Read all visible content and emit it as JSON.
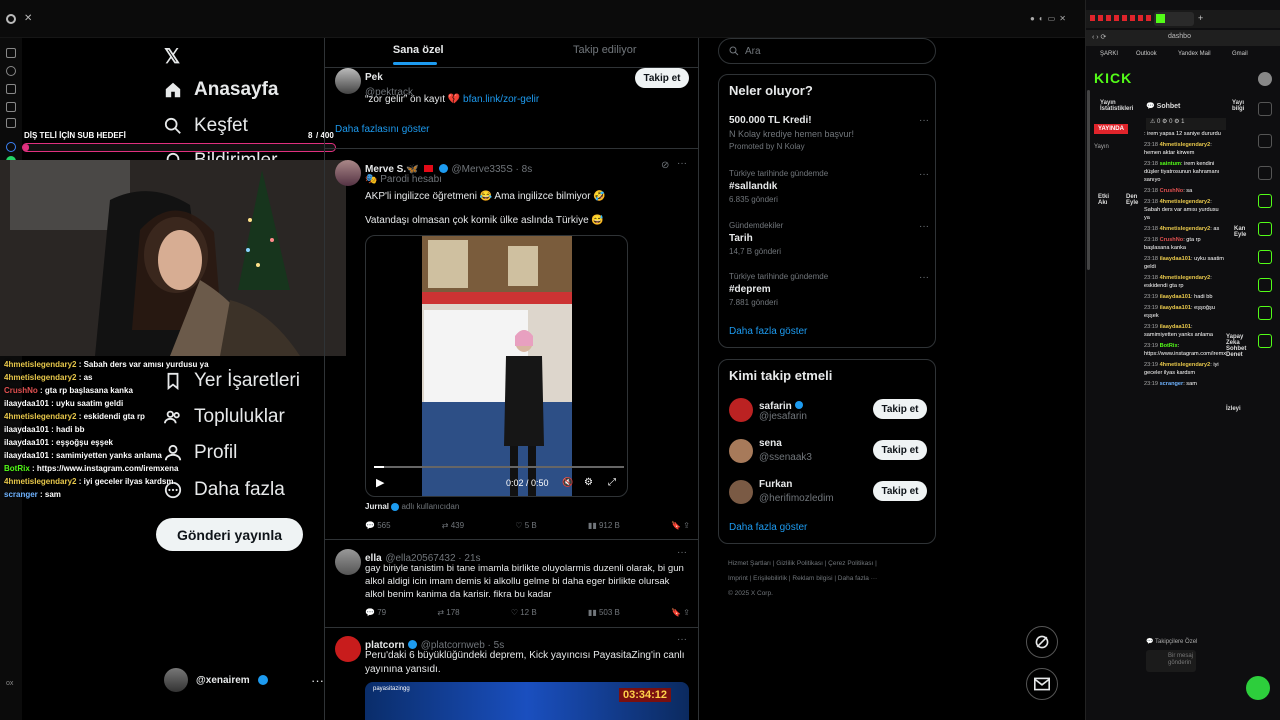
{
  "x_nav": {
    "home": "Anasayfa",
    "explore": "Keşfet",
    "notifications": "Bildirimler",
    "bookmarks": "Yer İşaretleri",
    "communities": "Topluluklar",
    "profile": "Profil",
    "more": "Daha fazla",
    "post_button": "Gönderi yayınla",
    "account_handle": "@xenairem"
  },
  "stream_overlay": {
    "sub_goal_label": "DİŞ TELİ İÇİN SUB HEDEFİ",
    "sub_goal_current": "8",
    "sub_goal_target": "/ 400",
    "sub_goal_progress": 0.02,
    "chat": [
      {
        "user": "4hmetislegendary2",
        "text": ": Sabah ders var amısı yurdusu ya"
      },
      {
        "user": "4hmetislegendary2",
        "text": ": as"
      },
      {
        "user": "CrushNo",
        "text": ": gta rp başlasana kanka"
      },
      {
        "user": "ilaaydaa101",
        "text": ": uyku saatim geldi"
      },
      {
        "user": "4hmetislegendary2",
        "text": ": eskidendi gta rp"
      },
      {
        "user": "ilaaydaa101",
        "text": ": hadi bb"
      },
      {
        "user": "ilaaydaa101",
        "text": ": eşşoğşu eşşek"
      },
      {
        "user": "ilaaydaa101",
        "text": ": samimiyetten yanks anlama"
      },
      {
        "user": "BotRix",
        "text": ": https://www.instagram.com/iremxena"
      },
      {
        "user": "4hmetislegendary2",
        "text": ": iyi geceler ilyas kardsm"
      },
      {
        "user": "scranger",
        "text": ": sam"
      }
    ]
  },
  "feed": {
    "tab_for_you": "Sana özel",
    "tab_following": "Takip ediliyor",
    "tweet1": {
      "name": "Pek",
      "handle": "@pektrack",
      "text": "“zor gelir” ön kayıt 💔",
      "link": "bfan.link/zor-gelir",
      "follow": "Takip et",
      "show_more": "Daha fazlasını göster"
    },
    "tweet2": {
      "name": "Merve S.🦋",
      "handle": "@Merve335S · 8s",
      "parody": "Parodi hesabı",
      "text1": "AKP'li ingilizce öğretmeni 😂 Ama ingilizce bilmiyor 🤣",
      "text2": "Vatandaşı olmasan çok komik ülke aslında Türkiye 😅",
      "video_time": "0:02 / 0:50",
      "source_name": "Jurnal",
      "source_suffix": "adlı kullanıcıdan",
      "replies": "565",
      "retweets": "439",
      "likes": "5 B",
      "views": "912 B"
    },
    "tweet3": {
      "name": "ella",
      "handle": "@ella20567432 · 21s",
      "text": "gay biriyle tanistim bi tane imamla birlikte oluyolarmis duzenli olarak, bi gun alkol aldigi icin imam demis ki alkollu gelme bi daha eger birlikte olursak alkol benim kanima da karisir. fikra bu kadar",
      "replies": "79",
      "retweets": "178",
      "likes": "12 B",
      "views": "503 B"
    },
    "tweet4": {
      "name": "platcorn",
      "handle": "@platcornweb · 5s",
      "text": "Peru'daki 6 büyüklüğündeki deprem, Kick yayıncısı PayasitaZing'in canlı yayınına yansıdı.",
      "video_label": "payasitazingg",
      "video_timer": "03:34:12"
    }
  },
  "right": {
    "search_placeholder": "Ara",
    "trends_title": "Neler oluyor?",
    "promo_title": "500.000 TL Kredi!",
    "promo_text": "N Kolay krediye hemen başvur!",
    "promo_by": "Promoted by N Kolay",
    "trends": [
      {
        "context": "Türkiye tarihinde gündemde",
        "name": "#sallandık",
        "count": "6.835 gönderi"
      },
      {
        "context": "Gündemdekiler",
        "name": "Tarih",
        "count": "14,7 B gönderi"
      },
      {
        "context": "Türkiye tarihinde gündemde",
        "name": "#deprem",
        "count": "7.881 gönderi"
      }
    ],
    "show_more": "Daha fazla göster",
    "who_title": "Kimi takip etmeli",
    "who": [
      {
        "name": "safarin",
        "handle": "@jesafarin",
        "btn": "Takip et"
      },
      {
        "name": "sena",
        "handle": "@ssenaak3",
        "btn": "Takip et"
      },
      {
        "name": "Furkan",
        "handle": "@herifimozledim",
        "btn": "Takip et"
      }
    ],
    "who_more": "Daha fazla göster",
    "footer1": "Hizmet Şartları  |  Gizlilik Politikası  |  Çerez Politikası  |",
    "footer2": "Imprint  |  Erişilebilirlik  |  Reklam bilgisi  |  Daha fazla ···",
    "footer3": "© 2025 X Corp."
  },
  "kick": {
    "url": "dashbo",
    "bookmarks": [
      "ŞARKI",
      "Outlook",
      "Yandex Mail",
      "Gmail"
    ],
    "logo": "KICK",
    "col_stats": "Yayın İstatistikleri",
    "col_chat": "Sohbet",
    "live_badge": "YAYINDA",
    "stream_label": "Yayın",
    "col_actions": "Etki Akı",
    "col_actions2": "Den Eyle",
    "col_channel": "Kan Eyle",
    "col_ai": "Yapay Zeka Sohbet Denet",
    "col_watch": "İzleyi",
    "col_info": "Yayı bilgi",
    "chat_placeholder": "Bir mesaj gönderin",
    "chat_footer": "Takipçilere Özel",
    "chat": [
      {
        "time": "",
        "user": "",
        "text": ": irem yapsa 12 saniye dururdu"
      },
      {
        "time": "23:18",
        "user": "4hmetislegendary2",
        "text": ": hemen aktar kirwem"
      },
      {
        "time": "23:18",
        "user": "saintum",
        "text": ": irem kendini düşler tiyatrosunun kahramanı sanıyo"
      },
      {
        "time": "23:18",
        "user": "CrushNo",
        "text": ": sa"
      },
      {
        "time": "23:18",
        "user": "4hmetislegendary2",
        "text": ": Sabah ders var amısı yurdusu ya"
      },
      {
        "time": "23:18",
        "user": "4hmetislegendary2",
        "text": ": as"
      },
      {
        "time": "23:18",
        "user": "CrushNo",
        "text": ": gta rp başlasana kanka"
      },
      {
        "time": "23:18",
        "user": "ilaaydaa101",
        "text": ": uyku saatim geldi"
      },
      {
        "time": "23:18",
        "user": "4hmetislegendary2",
        "text": ": eskidendi gta rp"
      },
      {
        "time": "23:19",
        "user": "ilaaydaa101",
        "text": ": hadi bb"
      },
      {
        "time": "23:19",
        "user": "ilaaydaa101",
        "text": ": eşşoğşu eşşek"
      },
      {
        "time": "23:19",
        "user": "ilaaydaa101",
        "text": ": samimiyetten yanks anlama"
      },
      {
        "time": "23:19",
        "user": "BotRix",
        "text": ": https://www.instagram.com/iremxena"
      },
      {
        "time": "23:19",
        "user": "4hmetislegendary2",
        "text": ": iyi geceler ilyas kardsm"
      },
      {
        "time": "23:19",
        "user": "scranger",
        "text": ": sam"
      }
    ]
  },
  "colors": {
    "accent": "#1d9bf0",
    "kick_green": "#53fc18",
    "live_red": "#e0242b",
    "goal_pink": "#e0307f"
  }
}
